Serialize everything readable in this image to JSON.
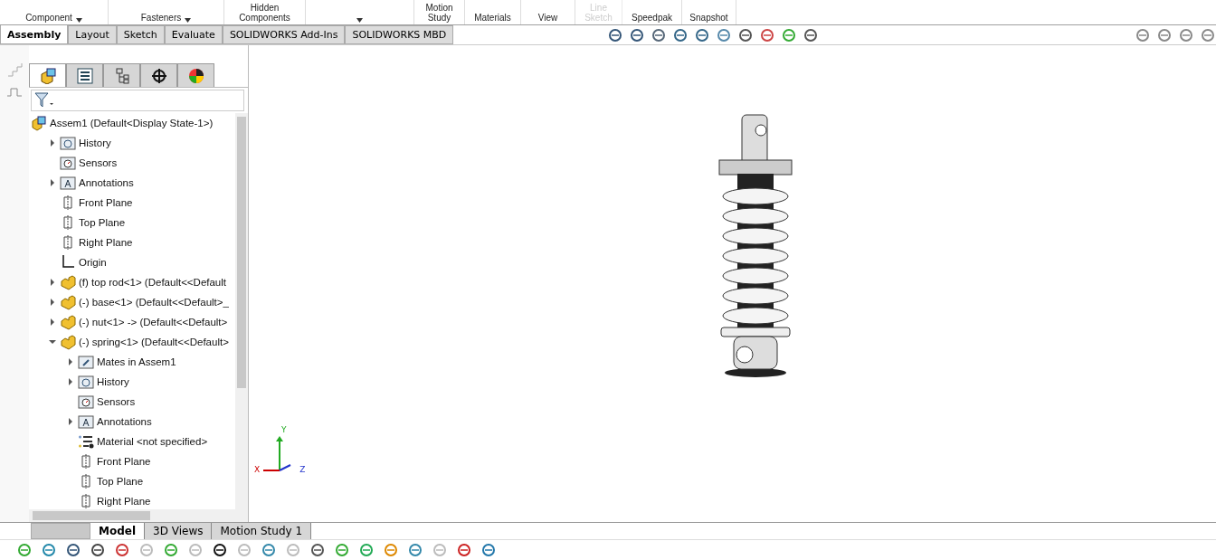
{
  "ribbon": {
    "groups": [
      {
        "label": "Component",
        "caret": true,
        "disabled": false
      },
      {
        "label": "Fasteners",
        "caret": true,
        "disabled": false
      },
      {
        "label": "Hidden Components",
        "caret": false,
        "disabled": false
      },
      {
        "caret": true,
        "disabled": false
      },
      {
        "label": "Motion Study",
        "caret": false,
        "disabled": false
      },
      {
        "label": "Materials",
        "caret": false,
        "disabled": false
      },
      {
        "label": "View",
        "caret": false,
        "disabled": false
      },
      {
        "label": "Line Sketch",
        "caret": false,
        "disabled": true
      },
      {
        "label": "Speedpak",
        "caret": false,
        "disabled": false
      },
      {
        "label": "Snapshot",
        "caret": false,
        "disabled": false
      }
    ]
  },
  "command_tabs": [
    {
      "label": "Assembly",
      "selected": true
    },
    {
      "label": "Layout",
      "selected": false
    },
    {
      "label": "Sketch",
      "selected": false
    },
    {
      "label": "Evaluate",
      "selected": false
    },
    {
      "label": "SOLIDWORKS Add-Ins",
      "selected": false
    },
    {
      "label": "SOLIDWORKS MBD",
      "selected": false
    }
  ],
  "manager_tabs": [
    {
      "kind": "feature",
      "selected": true
    },
    {
      "kind": "property",
      "selected": false
    },
    {
      "kind": "config",
      "selected": false
    },
    {
      "kind": "dim",
      "selected": false
    },
    {
      "kind": "display",
      "selected": false
    }
  ],
  "tree": [
    {
      "label": "Assem1  (Default<Display State-1>)",
      "kind": "assembly",
      "children": [
        {
          "label": "History",
          "kind": "history",
          "expanded": false
        },
        {
          "label": "Sensors",
          "kind": "sensors"
        },
        {
          "label": "Annotations",
          "kind": "annotations",
          "expanded": false
        },
        {
          "label": "Front Plane",
          "kind": "plane"
        },
        {
          "label": "Top Plane",
          "kind": "plane"
        },
        {
          "label": "Right Plane",
          "kind": "plane"
        },
        {
          "label": "Origin",
          "kind": "origin"
        },
        {
          "label": "(f) top rod<1> (Default<<Default",
          "kind": "part",
          "expanded": false
        },
        {
          "label": "(-) base<1> (Default<<Default>_",
          "kind": "part",
          "expanded": false
        },
        {
          "label": "(-) nut<1> -> (Default<<Default>",
          "kind": "part",
          "expanded": false
        },
        {
          "label": "(-) spring<1> (Default<<Default>",
          "kind": "part",
          "expanded": true,
          "children": [
            {
              "label": "Mates in Assem1",
              "kind": "mates",
              "expanded": false
            },
            {
              "label": "History",
              "kind": "history",
              "expanded": false
            },
            {
              "label": "Sensors",
              "kind": "sensors"
            },
            {
              "label": "Annotations",
              "kind": "annotations",
              "expanded": false
            },
            {
              "label": "Material <not specified>",
              "kind": "material"
            },
            {
              "label": "Front Plane",
              "kind": "plane"
            },
            {
              "label": "Top Plane",
              "kind": "plane"
            },
            {
              "label": "Right Plane",
              "kind": "plane"
            }
          ]
        }
      ]
    }
  ],
  "sheet_tabs": [
    {
      "label": "Model",
      "selected": true
    },
    {
      "label": "3D Views",
      "selected": false
    },
    {
      "label": "Motion Study 1",
      "selected": false
    }
  ],
  "triad": {
    "x": "X",
    "y": "Y",
    "z": "Z"
  }
}
